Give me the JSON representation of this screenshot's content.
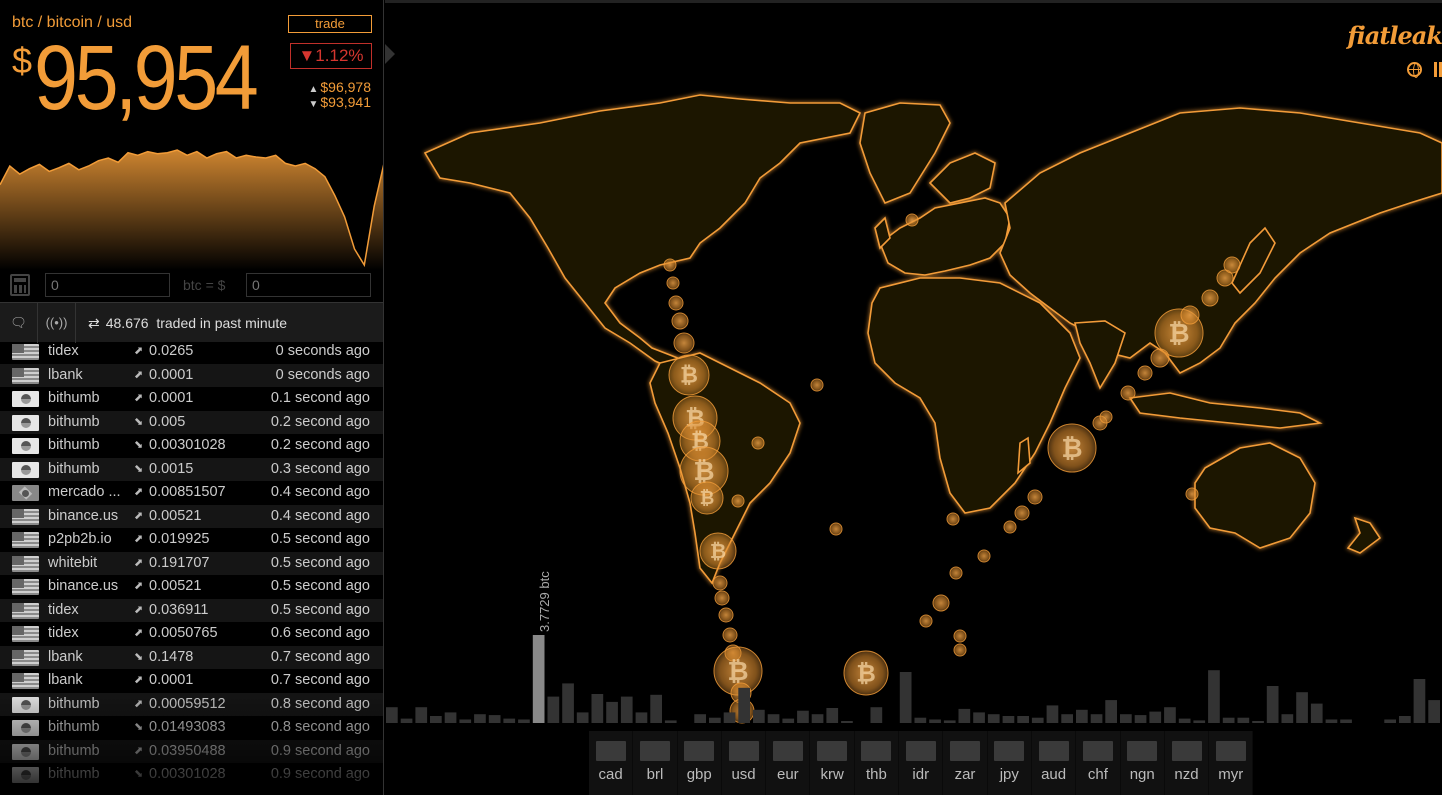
{
  "header": {
    "pair": "btc / bitcoin / usd",
    "trade_button": "trade",
    "currency_symbol": "$",
    "price": "95,954",
    "change": "▼1.12%",
    "high": "$96,978",
    "low": "$93,941"
  },
  "calculator": {
    "left_placeholder": "0",
    "right_placeholder": "0",
    "label": "btc = $"
  },
  "feed": {
    "volume": "48.676",
    "volume_text": "traded in past minute",
    "trades": [
      {
        "flag": "us",
        "exchange": "tidex",
        "side": "buy",
        "amount": "0.0265",
        "ago": "0 seconds ago"
      },
      {
        "flag": "us",
        "exchange": "lbank",
        "side": "buy",
        "amount": "0.0001",
        "ago": "0 seconds ago"
      },
      {
        "flag": "kr",
        "exchange": "bithumb",
        "side": "buy",
        "amount": "0.0001",
        "ago": "0.1 second ago"
      },
      {
        "flag": "kr",
        "exchange": "bithumb",
        "side": "sell",
        "amount": "0.005",
        "ago": "0.2 second ago"
      },
      {
        "flag": "kr",
        "exchange": "bithumb",
        "side": "sell",
        "amount": "0.00301028",
        "ago": "0.2 second ago"
      },
      {
        "flag": "kr",
        "exchange": "bithumb",
        "side": "sell",
        "amount": "0.0015",
        "ago": "0.3 second ago"
      },
      {
        "flag": "br",
        "exchange": "mercado ...",
        "side": "buy",
        "amount": "0.00851507",
        "ago": "0.4 second ago"
      },
      {
        "flag": "us",
        "exchange": "binance.us",
        "side": "buy",
        "amount": "0.00521",
        "ago": "0.4 second ago"
      },
      {
        "flag": "us",
        "exchange": "p2pb2b.io",
        "side": "buy",
        "amount": "0.019925",
        "ago": "0.5 second ago"
      },
      {
        "flag": "us",
        "exchange": "whitebit",
        "side": "buy",
        "amount": "0.191707",
        "ago": "0.5 second ago"
      },
      {
        "flag": "us",
        "exchange": "binance.us",
        "side": "buy",
        "amount": "0.00521",
        "ago": "0.5 second ago"
      },
      {
        "flag": "us",
        "exchange": "tidex",
        "side": "buy",
        "amount": "0.036911",
        "ago": "0.5 second ago"
      },
      {
        "flag": "us",
        "exchange": "tidex",
        "side": "buy",
        "amount": "0.0050765",
        "ago": "0.6 second ago"
      },
      {
        "flag": "us",
        "exchange": "lbank",
        "side": "sell",
        "amount": "0.1478",
        "ago": "0.7 second ago"
      },
      {
        "flag": "us",
        "exchange": "lbank",
        "side": "buy",
        "amount": "0.0001",
        "ago": "0.7 second ago"
      },
      {
        "flag": "kr",
        "exchange": "bithumb",
        "side": "buy",
        "amount": "0.00059512",
        "ago": "0.8 second ago"
      },
      {
        "flag": "kr",
        "exchange": "bithumb",
        "side": "sell",
        "amount": "0.01493083",
        "ago": "0.8 second ago"
      },
      {
        "flag": "kr",
        "exchange": "bithumb",
        "side": "buy",
        "amount": "0.03950488",
        "ago": "0.9 second ago"
      },
      {
        "flag": "kr",
        "exchange": "bithumb",
        "side": "sell",
        "amount": "0.00301028",
        "ago": "0.9 second ago"
      }
    ]
  },
  "map": {
    "logo": "fiatleak",
    "volume_label": "3.7729 btc",
    "accent_color": "#f29c38",
    "currencies": [
      "cad",
      "brl",
      "gbp",
      "usd",
      "eur",
      "krw",
      "thb",
      "idr",
      "zar",
      "jpy",
      "aud",
      "chf",
      "ngn",
      "nzd",
      "myr"
    ]
  },
  "sparkline": {
    "values": [
      95800,
      96150,
      96000,
      96100,
      96180,
      96050,
      96120,
      96200,
      96080,
      96150,
      96250,
      96300,
      96220,
      96400,
      96350,
      96420,
      96380,
      96400,
      96450,
      96350,
      96420,
      96300,
      96380,
      96420,
      96300,
      96350,
      96320,
      96300,
      96350,
      96200,
      96150,
      96200,
      96100,
      95950,
      95600,
      95200,
      94600,
      94300,
      95400,
      96200
    ]
  },
  "volume_bars": [
    0.18,
    0.05,
    0.18,
    0.08,
    0.12,
    0.04,
    0.1,
    0.09,
    0.05,
    0.04,
    1.0,
    0.3,
    0.45,
    0.12,
    0.33,
    0.24,
    0.3,
    0.12,
    0.32,
    0.03,
    0,
    0.1,
    0.06,
    0.12,
    0.4,
    0.15,
    0.1,
    0.05,
    0.14,
    0.1,
    0.17,
    0.01,
    0,
    0.18,
    0,
    0.58,
    0.06,
    0.04,
    0.03,
    0.16,
    0.12,
    0.1,
    0.08,
    0.08,
    0.06,
    0.2,
    0.1,
    0.15,
    0.1,
    0.26,
    0.1,
    0.09,
    0.13,
    0.18,
    0.05,
    0.03,
    0.6,
    0.06,
    0.06,
    0.02,
    0.42,
    0.1,
    0.35,
    0.22,
    0.04,
    0.04,
    0.0,
    0.0,
    0.04,
    0.08,
    0.5,
    0.26
  ]
}
